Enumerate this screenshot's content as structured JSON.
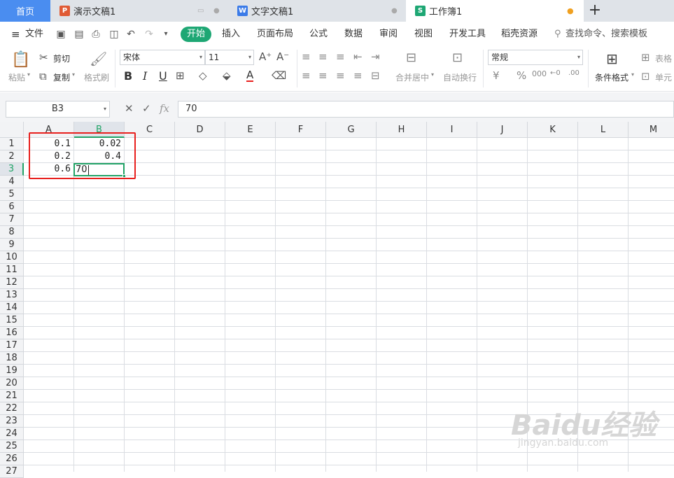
{
  "tabs": {
    "home": "首页",
    "items": [
      {
        "label": "演示文稿1",
        "icon": "P",
        "color": "#e05b35"
      },
      {
        "label": "文字文稿1",
        "icon": "W",
        "color": "#3b7be8"
      },
      {
        "label": "工作簿1",
        "icon": "S",
        "color": "#1ea774"
      }
    ],
    "add": "+"
  },
  "menu": {
    "file": "文件",
    "items": [
      "开始",
      "插入",
      "页面布局",
      "公式",
      "数据",
      "审阅",
      "视图",
      "开发工具",
      "稻壳资源"
    ],
    "search": "查找命令、搜索模板"
  },
  "ribbon": {
    "paste": "粘贴",
    "cut": "剪切",
    "copy": "复制",
    "format_painter": "格式刷",
    "font_name": "宋体",
    "font_size": "11",
    "bold": "B",
    "italic": "I",
    "underline": "U",
    "merge_center": "合并居中",
    "wrap_text": "自动换行",
    "number_format": "常规",
    "cond_format": "条件格式",
    "table_style": "表格",
    "cell_style": "单元"
  },
  "formula_bar": {
    "name_box": "B3",
    "fx": "fx",
    "value": "70"
  },
  "columns": [
    "A",
    "B",
    "C",
    "D",
    "E",
    "F",
    "G",
    "H",
    "I",
    "J",
    "K",
    "L",
    "M"
  ],
  "rows": [
    "1",
    "2",
    "3",
    "4",
    "5",
    "6",
    "7",
    "8",
    "9",
    "10",
    "11",
    "12",
    "13",
    "14",
    "15",
    "16",
    "17",
    "18",
    "19",
    "20",
    "21",
    "22",
    "23",
    "24",
    "25",
    "26",
    "27"
  ],
  "cells": {
    "A1": "0.1",
    "B1": "0.02",
    "A2": "0.2",
    "B2": "0.4",
    "A3": "0.6",
    "B3": "70"
  },
  "watermark": {
    "logo": "Baidu经验",
    "url": "jingyan.baidu.com"
  },
  "colors": {
    "accent": "#21a366",
    "highlight": "#e8201e",
    "home_tab": "#4a8df0"
  }
}
